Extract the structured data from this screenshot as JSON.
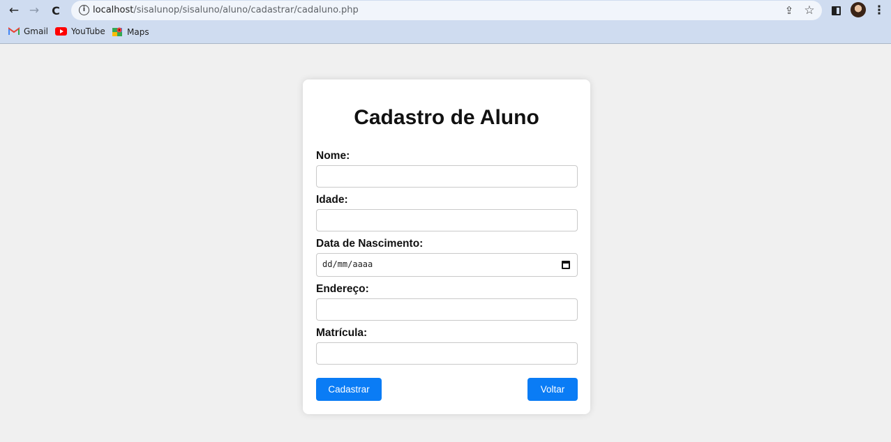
{
  "browser": {
    "url_host": "localhost",
    "url_path": "/sisalunop/sisaluno/aluno/cadastrar/cadaluno.php",
    "bookmarks": [
      {
        "label": "Gmail",
        "icon": "gmail-icon"
      },
      {
        "label": "YouTube",
        "icon": "youtube-icon"
      },
      {
        "label": "Maps",
        "icon": "maps-icon"
      }
    ],
    "icons": {
      "back": "←",
      "forward": "→",
      "reload": "C",
      "info": "i",
      "share": "⇪",
      "star": "☆",
      "menu": "⋮"
    }
  },
  "form": {
    "title": "Cadastro de Aluno",
    "fields": [
      {
        "label": "Nome:",
        "value": ""
      },
      {
        "label": "Idade:",
        "value": ""
      },
      {
        "label": "Data de Nascimento:",
        "value": "",
        "placeholder": "dd/mm/aaaa"
      },
      {
        "label": "Endereço:",
        "value": ""
      },
      {
        "label": "Matrícula:",
        "value": ""
      }
    ],
    "submit_label": "Cadastrar",
    "back_label": "Voltar"
  },
  "colors": {
    "button": "#0a7cf5",
    "page_background": "#f0f0f0",
    "chrome": "#cfdcf0"
  }
}
